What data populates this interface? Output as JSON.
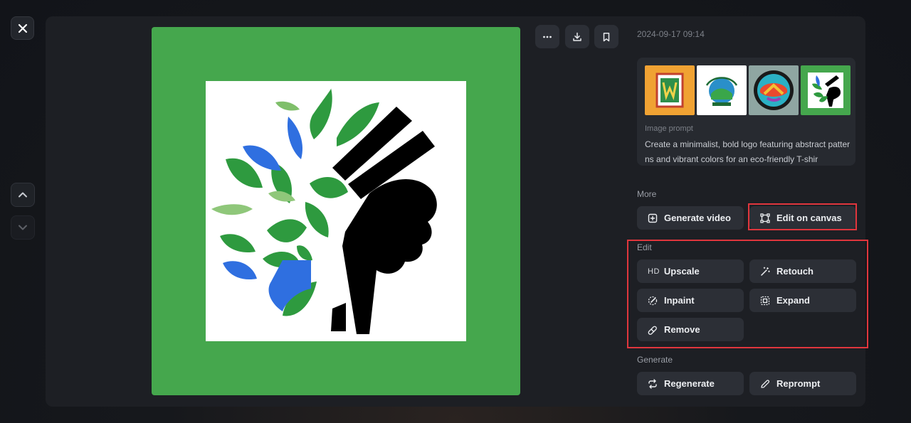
{
  "timestamp": "2024-09-17 09:14",
  "prompt": {
    "label": "Image prompt",
    "text": "Create a minimalist, bold logo featuring abstract patterns and vibrant colors for an eco-friendly T-shir"
  },
  "thumbnails": [
    "thumb-1",
    "thumb-2",
    "thumb-3",
    "thumb-4"
  ],
  "sections": {
    "more": {
      "label": "More",
      "generate_video": "Generate video",
      "edit_on_canvas": "Edit on canvas"
    },
    "edit": {
      "label": "Edit",
      "hd_badge": "HD",
      "upscale": "Upscale",
      "retouch": "Retouch",
      "inpaint": "Inpaint",
      "expand": "Expand",
      "remove": "Remove"
    },
    "generate": {
      "label": "Generate",
      "regenerate": "Regenerate",
      "reprompt": "Reprompt"
    }
  },
  "colors": {
    "image_bg": "#45a74d",
    "highlight": "#e0363d",
    "leaf_green": "#2e9a3f",
    "leaf_blue": "#2f6fe0"
  }
}
